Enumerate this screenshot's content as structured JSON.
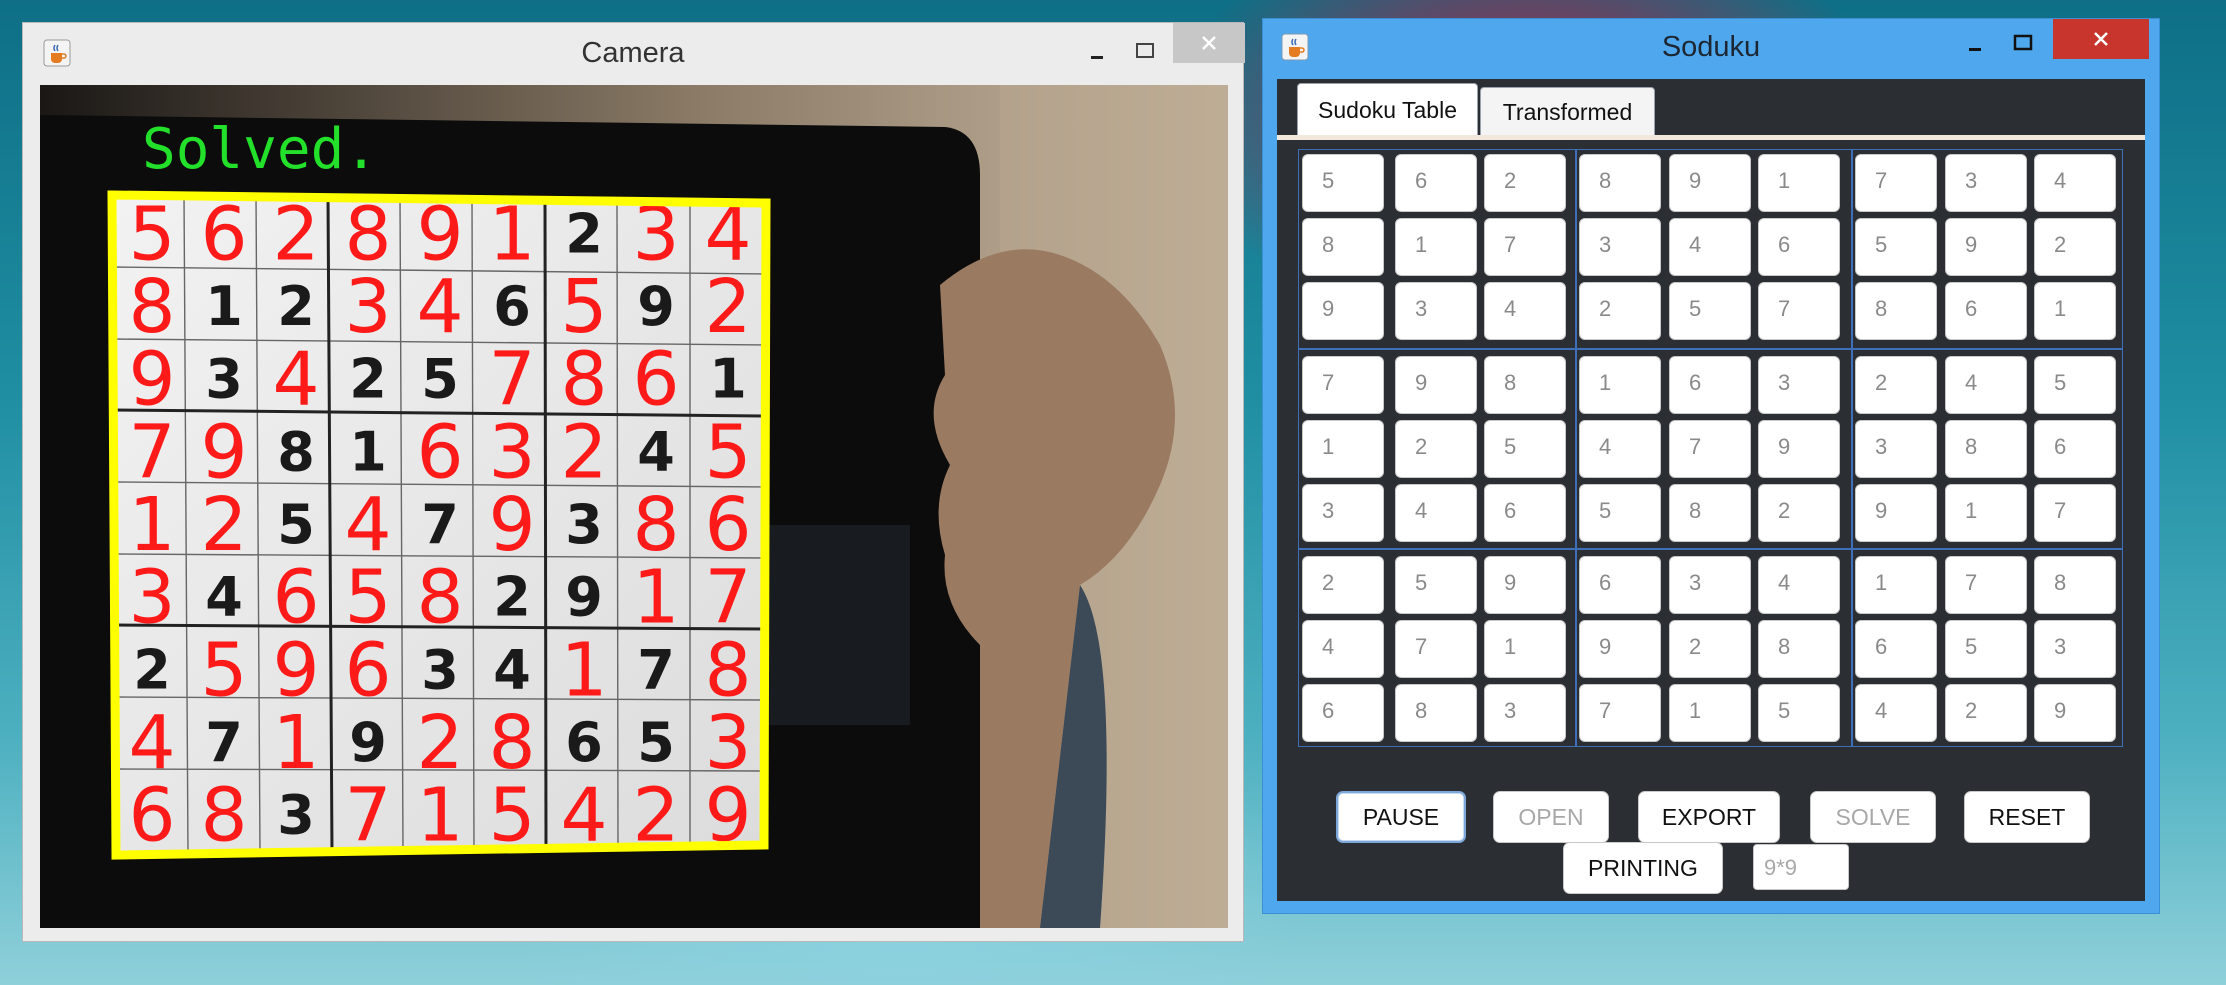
{
  "camera_window": {
    "title": "Camera",
    "status_text": "Solved.",
    "grid": [
      [
        "5",
        "6",
        "2",
        "8",
        "9",
        "1",
        "2",
        "3",
        "4"
      ],
      [
        "8",
        "1",
        "2",
        "3",
        "4",
        "6",
        "5",
        "9",
        "2"
      ],
      [
        "9",
        "3",
        "4",
        "2",
        "5",
        "7",
        "8",
        "6",
        "1"
      ],
      [
        "7",
        "9",
        "8",
        "1",
        "6",
        "3",
        "2",
        "4",
        "5"
      ],
      [
        "1",
        "2",
        "5",
        "4",
        "7",
        "9",
        "3",
        "8",
        "6"
      ],
      [
        "3",
        "4",
        "6",
        "5",
        "8",
        "2",
        "9",
        "1",
        "7"
      ],
      [
        "2",
        "5",
        "9",
        "6",
        "3",
        "4",
        "1",
        "7",
        "8"
      ],
      [
        "4",
        "7",
        "1",
        "9",
        "2",
        "8",
        "6",
        "5",
        "3"
      ],
      [
        "6",
        "8",
        "3",
        "7",
        "1",
        "5",
        "4",
        "2",
        "9"
      ]
    ],
    "printed_mask": [
      [
        0,
        0,
        0,
        0,
        0,
        0,
        1,
        0,
        0
      ],
      [
        0,
        1,
        1,
        0,
        0,
        1,
        0,
        1,
        0
      ],
      [
        0,
        1,
        0,
        1,
        1,
        0,
        0,
        0,
        1
      ],
      [
        0,
        0,
        1,
        1,
        0,
        0,
        0,
        1,
        0
      ],
      [
        0,
        0,
        1,
        0,
        1,
        0,
        1,
        0,
        0
      ],
      [
        0,
        1,
        0,
        0,
        0,
        1,
        1,
        0,
        0
      ],
      [
        1,
        0,
        0,
        0,
        1,
        1,
        0,
        1,
        0
      ],
      [
        0,
        1,
        0,
        1,
        0,
        0,
        1,
        1,
        0
      ],
      [
        0,
        0,
        1,
        0,
        0,
        0,
        0,
        0,
        0
      ]
    ],
    "colors": {
      "overlay": "#ff1a1a",
      "status": "#23e02a",
      "border": "#ffff00"
    }
  },
  "soduku_window": {
    "title": "Soduku",
    "tabs": [
      "Sudoku Table",
      "Transformed"
    ],
    "active_tab": "Sudoku Table",
    "grid": [
      [
        "5",
        "6",
        "2",
        "8",
        "9",
        "1",
        "7",
        "3",
        "4"
      ],
      [
        "8",
        "1",
        "7",
        "3",
        "4",
        "6",
        "5",
        "9",
        "2"
      ],
      [
        "9",
        "3",
        "4",
        "2",
        "5",
        "7",
        "8",
        "6",
        "1"
      ],
      [
        "7",
        "9",
        "8",
        "1",
        "6",
        "3",
        "2",
        "4",
        "5"
      ],
      [
        "1",
        "2",
        "5",
        "4",
        "7",
        "9",
        "3",
        "8",
        "6"
      ],
      [
        "3",
        "4",
        "6",
        "5",
        "8",
        "2",
        "9",
        "1",
        "7"
      ],
      [
        "2",
        "5",
        "9",
        "6",
        "3",
        "4",
        "1",
        "7",
        "8"
      ],
      [
        "4",
        "7",
        "1",
        "9",
        "2",
        "8",
        "6",
        "5",
        "3"
      ],
      [
        "6",
        "8",
        "3",
        "7",
        "1",
        "5",
        "4",
        "2",
        "9"
      ]
    ],
    "buttons": {
      "pause": "PAUSE",
      "open": "OPEN",
      "export": "EXPORT",
      "solve": "SOLVE",
      "reset": "RESET",
      "printing": "PRINTING"
    },
    "size_field": "9*9"
  },
  "icons": [
    "java-cup-icon",
    "minimize-icon",
    "maximize-icon",
    "close-icon"
  ]
}
